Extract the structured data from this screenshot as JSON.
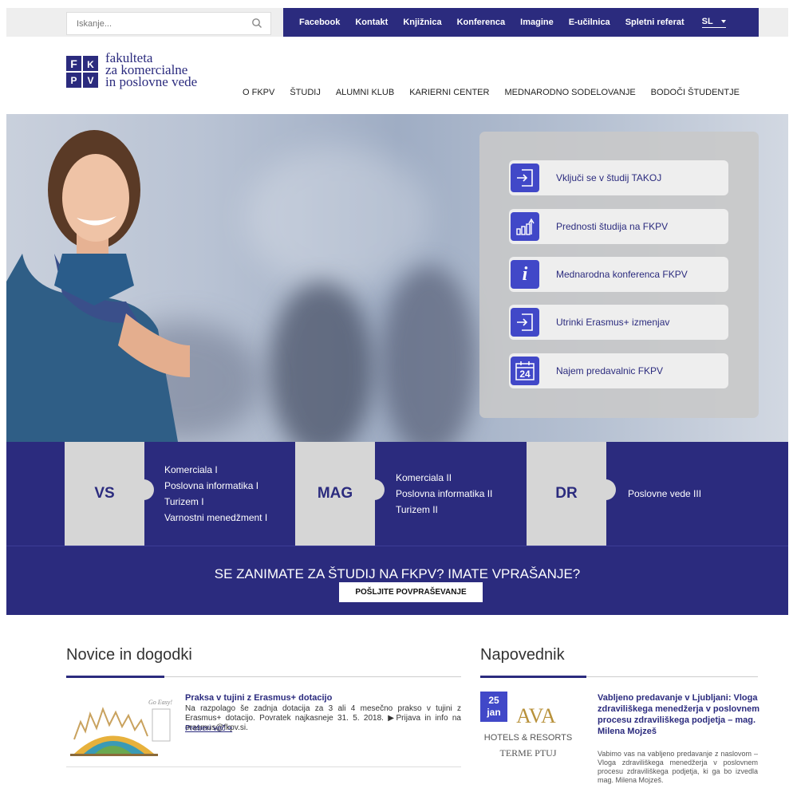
{
  "search": {
    "placeholder": "Iskanje..."
  },
  "toplinks": [
    "Facebook",
    "Kontakt",
    "Knjižnica",
    "Konferenca",
    "Imagine",
    "E-učilnica",
    "Spletni referat"
  ],
  "language": "SL",
  "logo": {
    "letters": [
      "F",
      "K",
      "P",
      "V"
    ],
    "lines": [
      "fakulteta",
      "za komercialne",
      "in poslovne vede"
    ]
  },
  "nav": [
    "O FKPV",
    "ŠTUDIJ",
    "ALUMNI KLUB",
    "KARIERNI CENTER",
    "MEDNARODNO SODELOVANJE",
    "BODOČI ŠTUDENTJE"
  ],
  "hero_buttons": [
    {
      "label": "Vključi se v študij TAKOJ",
      "icon": "enter-icon"
    },
    {
      "label": "Prednosti študija na FKPV",
      "icon": "growth-chart-icon"
    },
    {
      "label": "Mednarodna konferenca FKPV",
      "icon": "info-icon",
      "glyph": "i"
    },
    {
      "label": "Utrinki Erasmus+ izmenjav",
      "icon": "enter-icon"
    },
    {
      "label": "Najem predavalnic FKPV",
      "icon": "calendar-icon",
      "glyph": "24"
    }
  ],
  "levels": [
    {
      "code": "VS",
      "programs": [
        "Komerciala I",
        "Poslovna informatika I",
        "Turizem I",
        "Varnostni menedžment I"
      ]
    },
    {
      "code": "MAG",
      "programs": [
        "Komerciala II",
        "Poslovna informatika II",
        "Turizem II"
      ]
    },
    {
      "code": "DR",
      "programs": [
        "Poslovne vede III"
      ]
    }
  ],
  "cta": {
    "title": "SE ZANIMATE ZA ŠTUDIJ NA FKPV? IMATE VPRAŠANJE?",
    "button": "POŠLJITE POVPRAŠEVANJE"
  },
  "news": {
    "heading": "Novice in dogodki",
    "items": [
      {
        "title": "Praksa v tujini z Erasmus+ dotacijo",
        "text": "Na razpolago še zadnja dotacija za 3 ali 4 mesečno prakso v tujini z Erasmus+ dotacijo. Povratek najkasneje 31. 5. 2018. ▶Prijava in info na erasmus@fkpv.si.",
        "more": "Preberi več >",
        "thumb_text": "Go Easy!"
      }
    ]
  },
  "events": {
    "heading": "Napovednik",
    "items": [
      {
        "day": "25",
        "month": "jan",
        "logo_line1": "AVA",
        "logo_line2": "HOTELS & RESORTS",
        "logo_line3": "TERME PTUJ",
        "title": "Vabljeno predavanje v Ljubljani: Vloga zdraviliškega menedžerja v poslovnem procesu zdraviliškega podjetja – mag. Milena Mojzeš",
        "text": "Vabimo vas na vabljeno predavanje z naslovom – Vloga zdraviliškega menedžerja v poslovnem procesu zdraviliškega podjetja, ki ga bo izvedla mag. Milena Mojzeš."
      }
    ]
  },
  "colors": {
    "brand": "#2b2b7e",
    "accent": "#4148c8",
    "puzzle": "#d6d6d6",
    "logo_gold": "#b8913a"
  }
}
